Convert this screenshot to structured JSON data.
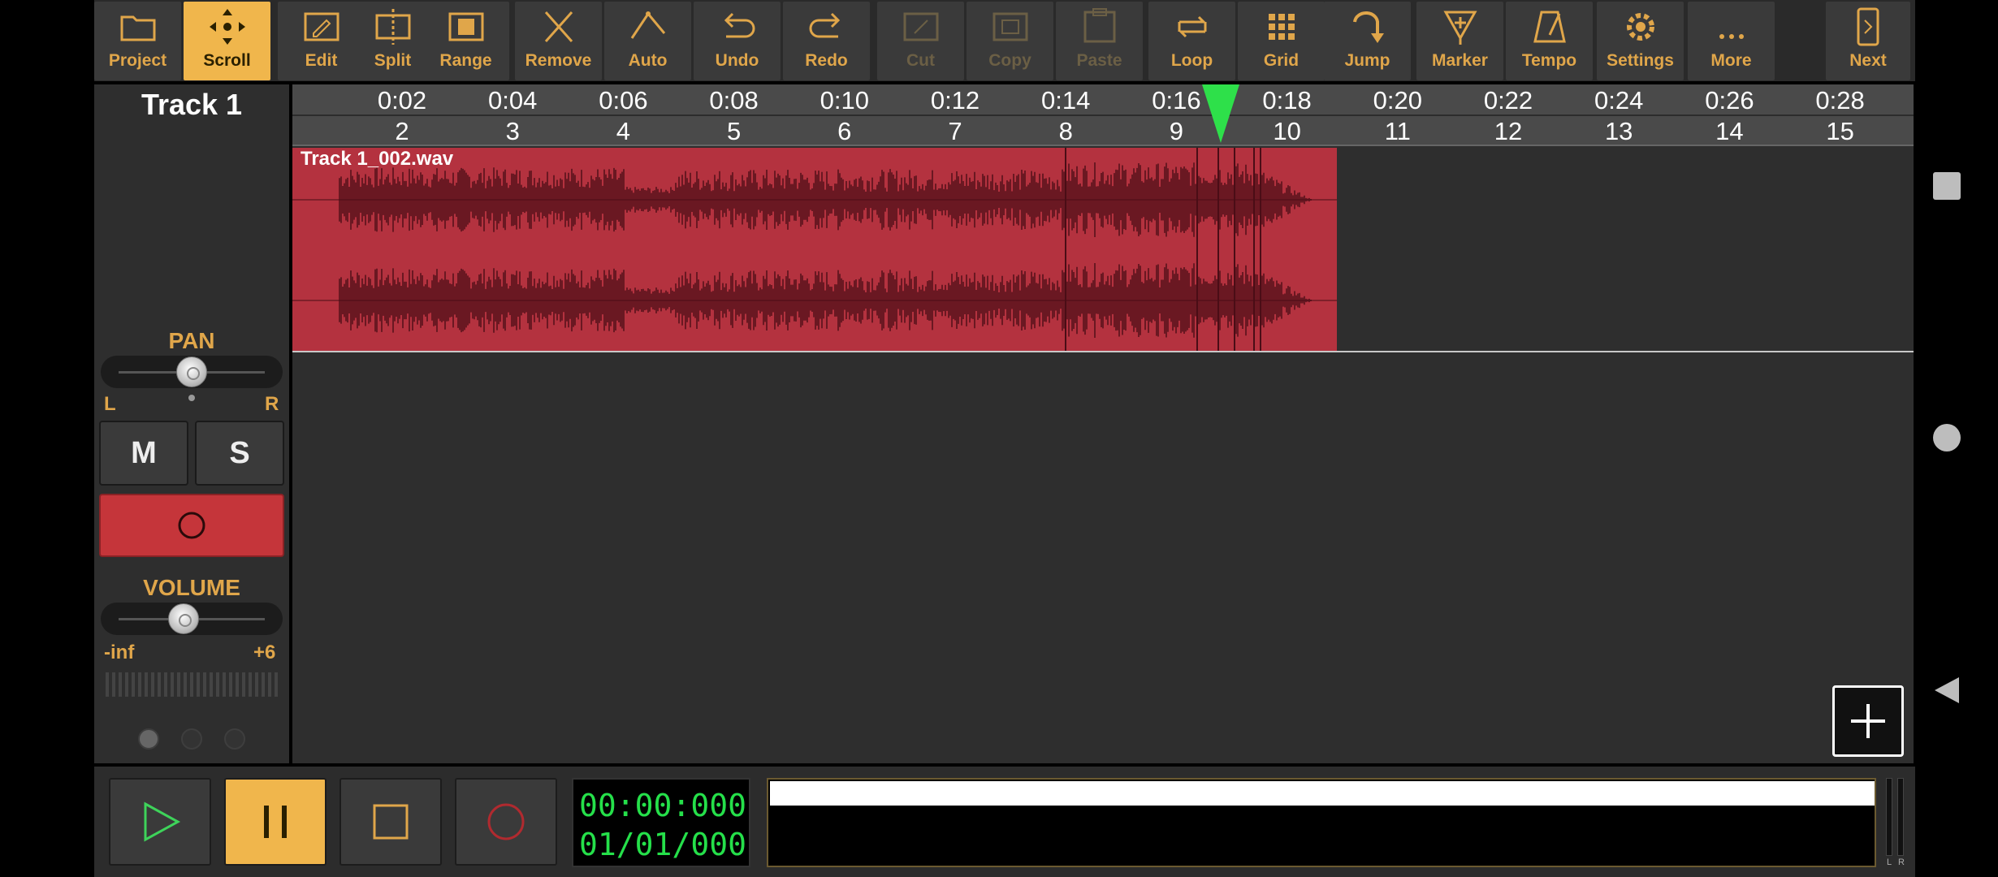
{
  "toolbar": {
    "tools": [
      {
        "label": "Project",
        "icon": "folder-icon",
        "state": "normal"
      },
      {
        "label": "Scroll",
        "icon": "scroll-arrows-icon",
        "state": "active"
      },
      {
        "label": "Edit",
        "icon": "pencil-icon",
        "state": "normal"
      },
      {
        "label": "Split",
        "icon": "split-icon",
        "state": "normal"
      },
      {
        "label": "Range",
        "icon": "range-icon",
        "state": "normal"
      },
      {
        "label": "Remove",
        "icon": "x-icon",
        "state": "normal"
      },
      {
        "label": "Auto",
        "icon": "automation-icon",
        "state": "normal"
      },
      {
        "label": "Undo",
        "icon": "undo-icon",
        "state": "normal"
      },
      {
        "label": "Redo",
        "icon": "redo-icon",
        "state": "normal"
      },
      {
        "label": "Cut",
        "icon": "scissors-icon",
        "state": "disabled"
      },
      {
        "label": "Copy",
        "icon": "copy-icon",
        "state": "disabled"
      },
      {
        "label": "Paste",
        "icon": "paste-icon",
        "state": "disabled"
      },
      {
        "label": "Loop",
        "icon": "loop-icon",
        "state": "normal"
      },
      {
        "label": "Grid",
        "icon": "grid-icon",
        "state": "normal"
      },
      {
        "label": "Jump",
        "icon": "jump-icon",
        "state": "normal"
      },
      {
        "label": "Marker",
        "icon": "marker-icon",
        "state": "normal"
      },
      {
        "label": "Tempo",
        "icon": "metronome-icon",
        "state": "normal"
      },
      {
        "label": "Settings",
        "icon": "gear-icon",
        "state": "normal"
      },
      {
        "label": "More",
        "icon": "ellipsis-icon",
        "state": "normal"
      },
      {
        "label": "Next",
        "icon": "next-icon",
        "state": "normal"
      }
    ]
  },
  "track": {
    "name": "Track 1",
    "pan_label": "PAN",
    "pan_left": "L",
    "pan_right": "R",
    "pan_value": 0.5,
    "mute_label": "M",
    "solo_label": "S",
    "volume_label": "VOLUME",
    "volume_min": "-inf",
    "volume_max": "+6",
    "volume_value": 0.43
  },
  "ruler": {
    "times": [
      "0:02",
      "0:04",
      "0:06",
      "0:08",
      "0:10",
      "0:12",
      "0:14",
      "0:16",
      "0:18",
      "0:20",
      "0:22",
      "0:24",
      "0:26",
      "0:28"
    ],
    "bars": [
      "2",
      "3",
      "4",
      "5",
      "6",
      "7",
      "8",
      "9",
      "10",
      "11",
      "12",
      "13",
      "14",
      "15"
    ]
  },
  "clip": {
    "name": "Track 1_002.wav"
  },
  "transport": {
    "time": "00:00:000",
    "bbt": "01/01/000",
    "level_captions": [
      "L",
      "R"
    ]
  },
  "colors": {
    "accent": "#f0b64c",
    "clip": "#b4323f",
    "playhead": "#2ee04a",
    "counter": "#25e04a"
  }
}
